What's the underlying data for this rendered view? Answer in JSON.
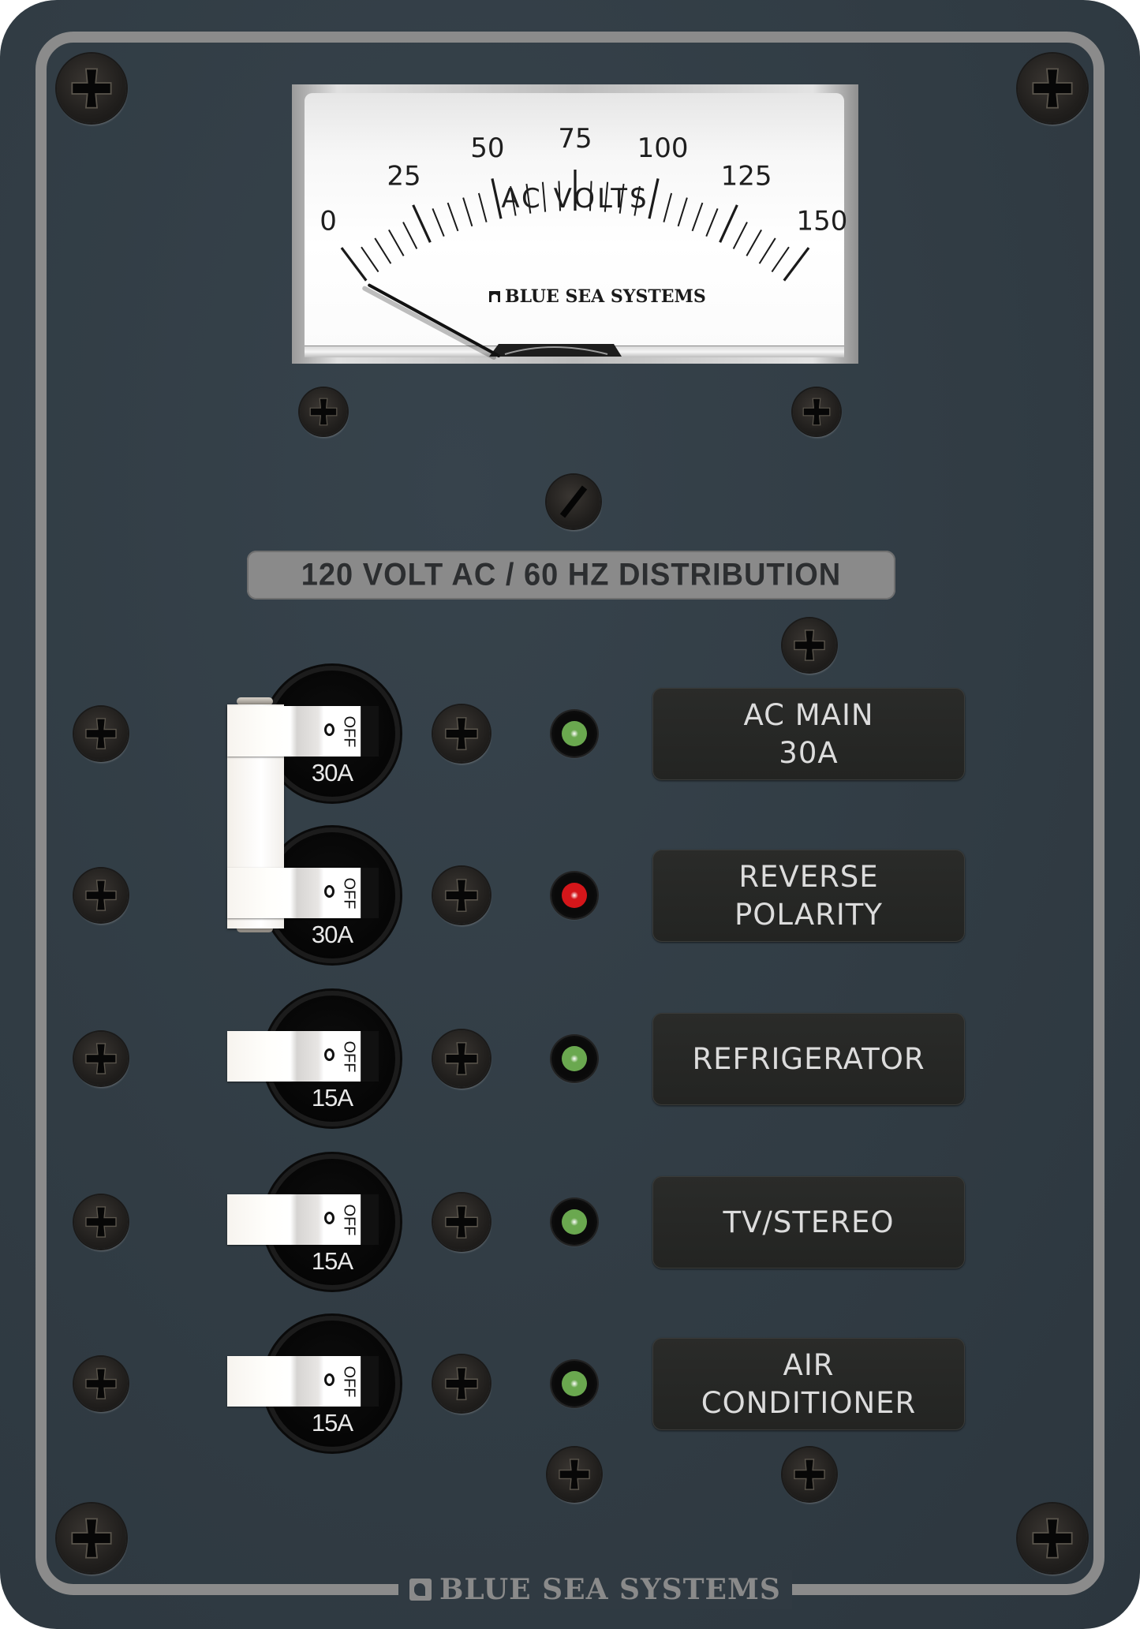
{
  "panel": {
    "brand": "BLUE SEA SYSTEMS",
    "colors": {
      "panel": "#323d45",
      "border": "#8b8b8b",
      "label_plate": "#272826",
      "label_text": "#dcdcdc",
      "banner": "#8a8a8a",
      "banner_text": "#2c2e30",
      "led_green": "#6aa84f",
      "led_red": "#d4161a"
    }
  },
  "meter": {
    "units_label": "AC VOLTS",
    "brand": "BLUE SEA SYSTEMS",
    "scale_min": 0,
    "scale_max": 150,
    "minor_step": 5,
    "major_step": 25,
    "tick_labels": [
      "0",
      "25",
      "50",
      "75",
      "100",
      "125",
      "150"
    ],
    "needle_value": 0
  },
  "banner": {
    "text": "120 VOLT AC / 60 HZ DISTRIBUTION"
  },
  "circuits": [
    {
      "name": "ac-main",
      "label_lines": [
        "AC MAIN",
        "30A"
      ],
      "rating": "30A",
      "switch_text": "OFF",
      "switch_state": "OFF",
      "led": "green",
      "led_color": "#6aa84f",
      "tied": true
    },
    {
      "name": "reverse-polarity",
      "label_lines": [
        "REVERSE",
        "POLARITY"
      ],
      "rating": "30A",
      "switch_text": "OFF",
      "switch_state": "OFF",
      "led": "red",
      "led_color": "#d4161a",
      "tied": true
    },
    {
      "name": "refrigerator",
      "label_lines": [
        "REFRIGERATOR"
      ],
      "rating": "15A",
      "switch_text": "OFF",
      "switch_state": "OFF",
      "led": "green",
      "led_color": "#6aa84f",
      "tied": false
    },
    {
      "name": "tv-stereo",
      "label_lines": [
        "TV/STEREO"
      ],
      "rating": "15A",
      "switch_text": "OFF",
      "switch_state": "OFF",
      "led": "green",
      "led_color": "#6aa84f",
      "tied": false
    },
    {
      "name": "air-conditioner",
      "label_lines": [
        "AIR",
        "CONDITIONER"
      ],
      "rating": "15A",
      "switch_text": "OFF",
      "switch_state": "OFF",
      "led": "green",
      "led_color": "#6aa84f",
      "tied": false
    }
  ],
  "footer": {
    "logo_text": "BLUE SEA SYSTEMS",
    "logo_icon": "blue-sea-wave-icon"
  }
}
